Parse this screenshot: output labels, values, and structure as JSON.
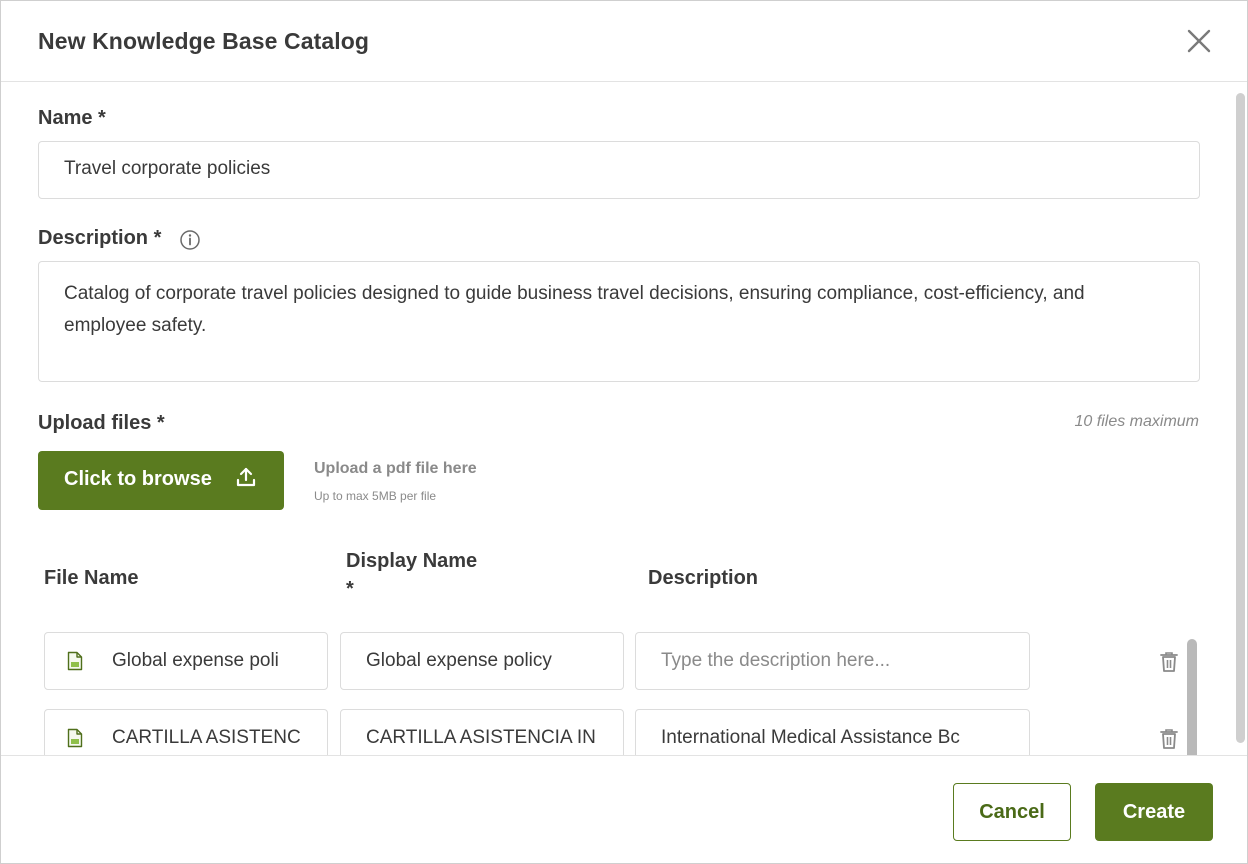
{
  "dialog": {
    "title": "New Knowledge Base Catalog",
    "close_icon": "close-icon"
  },
  "form": {
    "name": {
      "label": "Name *",
      "value": "Travel corporate policies"
    },
    "description": {
      "label": "Description *",
      "info_icon": "info-icon",
      "value": "Catalog of corporate travel policies designed to guide business travel decisions, ensuring compliance, cost-efficiency, and employee safety."
    },
    "upload": {
      "label": "Upload files *",
      "max_note": "10 files maximum",
      "browse_label": "Click to browse",
      "browse_icon": "upload-icon",
      "hint": "Upload a pdf file here",
      "subhint": "Up to max 5MB per file"
    }
  },
  "table": {
    "headers": {
      "file_name": "File Name",
      "display_name_line1": "Display Name",
      "display_name_line2": "*",
      "description": "Description"
    },
    "rows": [
      {
        "file_name": "Global expense poli",
        "display_name": "Global expense policy",
        "description": "",
        "description_placeholder": "Type the description here..."
      },
      {
        "file_name": "CARTILLA ASISTENC",
        "display_name": "CARTILLA ASISTENCIA IN",
        "description": "International Medical Assistance Bc",
        "description_placeholder": ""
      }
    ]
  },
  "footer": {
    "cancel_label": "Cancel",
    "create_label": "Create"
  },
  "colors": {
    "primary": "#5a7b1f",
    "border": "#dcdcdc",
    "muted_text": "#8a8a8a"
  }
}
